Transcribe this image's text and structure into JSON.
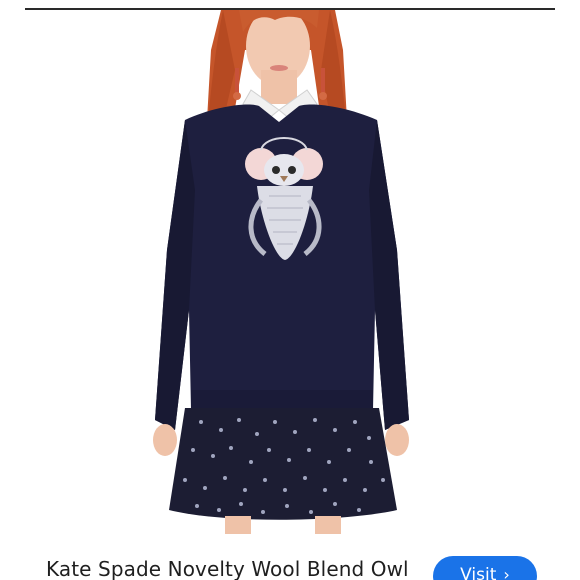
{
  "product": {
    "title": "Kate Spade Novelty Wool Blend Owl",
    "image_alt": "Model wearing navy sweater with owl appliqué over a dotted skirt"
  },
  "actions": {
    "visit_label": "Visit",
    "visit_icon": "chevron-right-icon"
  },
  "colors": {
    "accent": "#1a73e8",
    "sweater": "#1e1f3f",
    "hair": "#c75a2e"
  }
}
